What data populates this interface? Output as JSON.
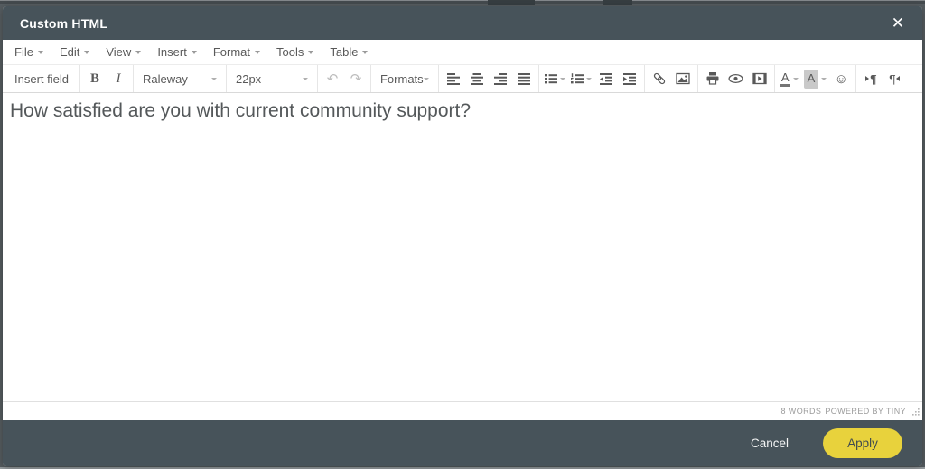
{
  "dialog": {
    "title": "Custom HTML",
    "close_glyph": "✕"
  },
  "menubar": {
    "items": [
      {
        "label": "File"
      },
      {
        "label": "Edit"
      },
      {
        "label": "View"
      },
      {
        "label": "Insert"
      },
      {
        "label": "Format"
      },
      {
        "label": "Tools"
      },
      {
        "label": "Table"
      }
    ]
  },
  "toolbar": {
    "insert_field_label": "Insert field",
    "bold_glyph": "B",
    "italic_glyph": "I",
    "font_family_value": "Raleway",
    "font_size_value": "22px",
    "undo_glyph": "↶",
    "redo_glyph": "↷",
    "formats_label": "Formats",
    "forecolor_letter": "A",
    "backcolor_letter": "A",
    "emoticon_glyph": "☺",
    "ltr_glyph": "¶",
    "rtl_glyph": "¶"
  },
  "icons": {
    "close": "x-mark",
    "align_left": "bars-left",
    "align_center": "bars-center",
    "align_right": "bars-right",
    "align_justify": "bars-full",
    "bullet_list": "dotted-lines",
    "numbered_list": "numbered-lines",
    "outdent": "lines-arrow-left",
    "indent": "lines-arrow-right",
    "link": "chain",
    "image": "picture-frame",
    "print": "printer",
    "preview": "eye",
    "media": "filmstrip-play",
    "resize_grip": "diagonal-dots"
  },
  "editor": {
    "content": "How satisfied are you with current community support?"
  },
  "statusbar": {
    "word_count": "8 WORDS",
    "branding": "POWERED BY TINY"
  },
  "footer": {
    "cancel_label": "Cancel",
    "apply_label": "Apply"
  },
  "colors": {
    "header_bg": "#47535a",
    "footer_bg": "#47535a",
    "backdrop": "#575e62",
    "apply_bg": "#e8d23c",
    "apply_text": "#3f4a50",
    "menu_text": "#595959",
    "toolbar_icon": "#595959",
    "content_text": "#54585a",
    "statusbar_text": "#9b9b9b"
  }
}
